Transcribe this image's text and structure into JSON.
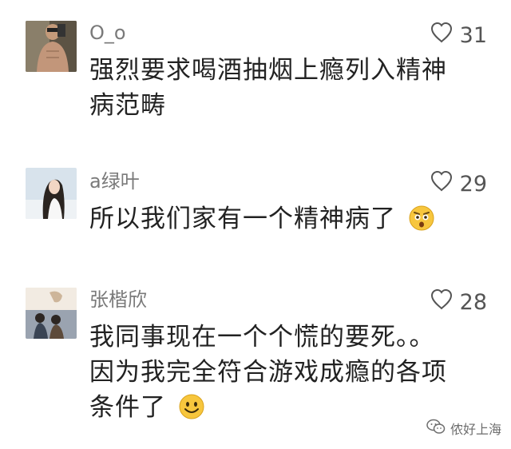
{
  "comments": [
    {
      "name": "O_o",
      "likes": "31",
      "text_lines": [
        "强烈要求喝酒抽烟上瘾列入精神",
        "病范畴"
      ],
      "emoji": ""
    },
    {
      "name": "a绿叶",
      "likes": "29",
      "text_lines": [
        "所以我们家有一个精神病了"
      ],
      "emoji": "surprised-face"
    },
    {
      "name": "张楷欣",
      "likes": "28",
      "text_lines": [
        "我同事现在一个个慌的要死。。",
        "因为我完全符合游戏成瘾的各项",
        "条件了"
      ],
      "emoji": "smiling-face"
    }
  ],
  "watermark": {
    "text": "侬好上海",
    "icon": "wechat-icon"
  },
  "colors": {
    "name": "#7a7a7a",
    "text": "#222222",
    "heart": "#555555"
  }
}
